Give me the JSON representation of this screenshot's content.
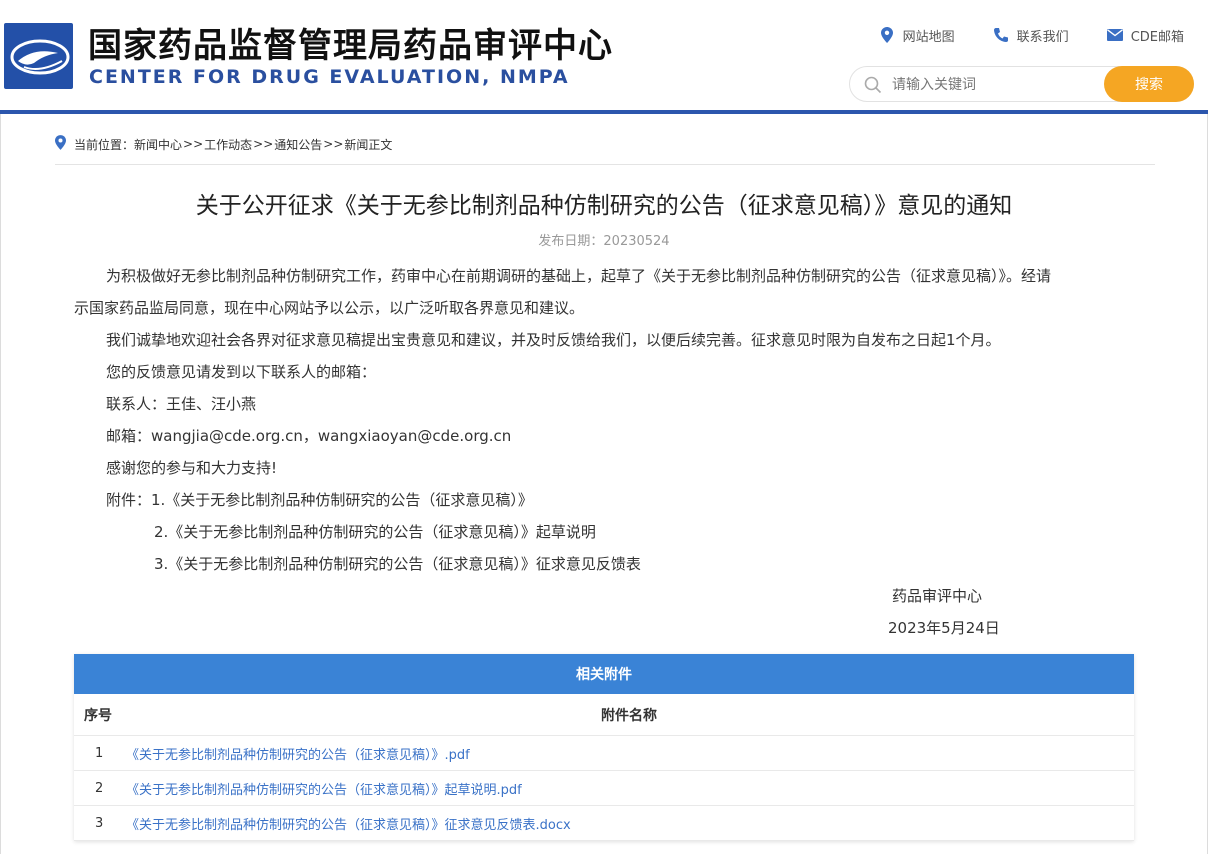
{
  "header": {
    "title_cn": "国家药品监督管理局药品审评中心",
    "title_en": "CENTER FOR DRUG EVALUATION, NMPA",
    "links": [
      {
        "label": "网站地图",
        "icon": "location-pin-icon"
      },
      {
        "label": "联系我们",
        "icon": "phone-icon"
      },
      {
        "label": "CDE邮箱",
        "icon": "mail-icon"
      }
    ],
    "search": {
      "placeholder": "请输入关键词",
      "button": "搜索"
    },
    "accent_color": "#2c56ad",
    "button_color": "#f5a623"
  },
  "breadcrumb": {
    "prefix": "当前位置：",
    "items": [
      "新闻中心",
      "工作动态",
      "通知公告",
      "新闻正文"
    ],
    "separator": ">>"
  },
  "article": {
    "title": "关于公开征求《关于无参比制剂品种仿制研究的公告（征求意见稿）》意见的通知",
    "date": "发布日期：20230524",
    "paragraphs": [
      "为积极做好无参比制剂品种仿制研究工作，药审中心在前期调研的基础上，起草了《关于无参比制剂品种仿制研究的公告（征求意见稿）》。经请",
      "示国家药品监局同意，现在中心网站予以公示，以广泛听取各界意见和建议。",
      "我们诚挚地欢迎社会各界对征求意见稿提出宝贵意见和建议，并及时反馈给我们，以便后续完善。征求意见时限为自发布之日起1个月。",
      "您的反馈意见请发到以下联系人的邮箱：",
      "联系人：王佳、汪小燕",
      "邮箱：wangjia@cde.org.cn，wangxiaoyan@cde.org.cn",
      "感谢您的参与和大力支持!",
      "附件：1.《关于无参比制剂品种仿制研究的公告（征求意见稿）》",
      "2.《关于无参比制剂品种仿制研究的公告（征求意见稿）》起草说明",
      "3.《关于无参比制剂品种仿制研究的公告（征求意见稿）》征求意见反馈表"
    ],
    "signature": "药品审评中心",
    "sign_date": "2023年5月24日"
  },
  "attachments": {
    "title": "相关附件",
    "col_no": "序号",
    "col_name": "附件名称",
    "rows": [
      {
        "no": "1",
        "name": "《关于无参比制剂品种仿制研究的公告（征求意见稿）》.pdf"
      },
      {
        "no": "2",
        "name": "《关于无参比制剂品种仿制研究的公告（征求意见稿）》起草说明.pdf"
      },
      {
        "no": "3",
        "name": "《关于无参比制剂品种仿制研究的公告（征求意见稿）》征求意见反馈表.docx"
      }
    ]
  }
}
